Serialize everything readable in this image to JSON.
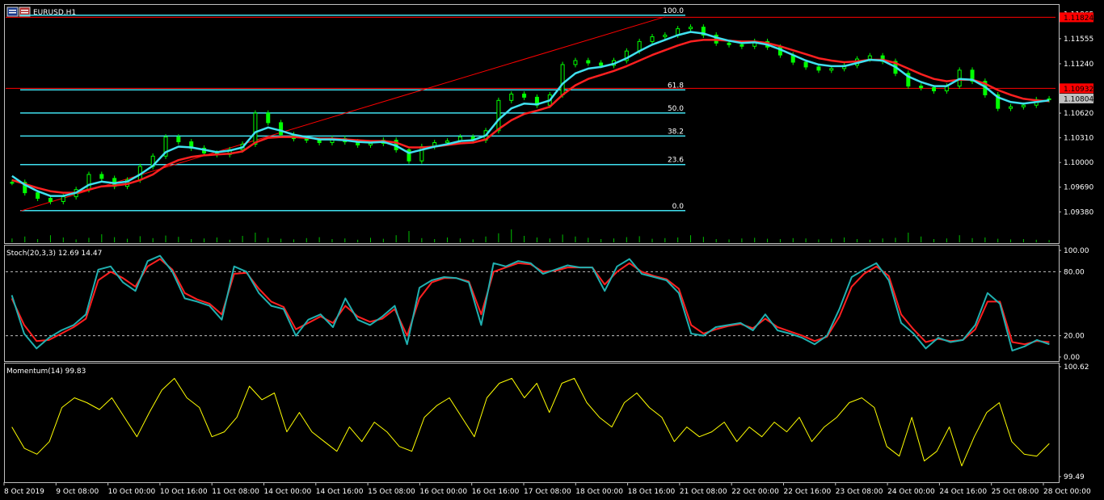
{
  "window": {
    "title": "EURUSD,H1",
    "icon": "window-icon"
  },
  "colors": {
    "background": "#000000",
    "frame": "#c0c0c0",
    "bull_candle": "#00ff00",
    "ma_fast": "#40e0f0",
    "ma_slow": "#ff2020",
    "fibo": "#40e0f0",
    "trendline": "#ff0000",
    "volume": "#00c000",
    "stoch_main": "#20b0b0",
    "stoch_signal": "#ff2020",
    "momentum": "#ffff00",
    "level_line": "#c0c0c0",
    "price_tag_high": "#ff0000",
    "price_tag_current": "#c0c0c0"
  },
  "chart_data": [
    {
      "type": "line",
      "subtype": "candlestick",
      "title": "EURUSD,H1",
      "ylim": [
        1.0918,
        1.1196
      ],
      "price_axis_labels": [
        "1.11865",
        "1.11555",
        "1.11240",
        "1.10932",
        "1.10620",
        "1.10310",
        "1.10000",
        "1.09690",
        "1.09380"
      ],
      "price_axis_values": [
        1.11865,
        1.11555,
        1.1124,
        1.10932,
        1.1062,
        1.1031,
        1.1,
        1.0969,
        1.0938
      ],
      "price_tags": [
        {
          "label": "1.11824",
          "value": 1.11824,
          "color": "#ff0000"
        },
        {
          "label": "1.10932",
          "value": 1.10932,
          "color": "#ff0000"
        },
        {
          "label": "1.10804",
          "value": 1.10804,
          "color": "#c0c0c0"
        }
      ],
      "horizontal_lines": [
        1.11824,
        1.10932
      ],
      "fibonacci": {
        "low": 1.09395,
        "high": 1.1185,
        "levels": [
          {
            "label": "100.0",
            "ratio": 1.0
          },
          {
            "label": "61.8",
            "ratio": 0.618
          },
          {
            "label": "50.0",
            "ratio": 0.5
          },
          {
            "label": "38.2",
            "ratio": 0.382
          },
          {
            "label": "23.6",
            "ratio": 0.236
          },
          {
            "label": "0.0",
            "ratio": 0.0
          }
        ]
      },
      "trendline": {
        "from": {
          "bar": 0.014,
          "value": 1.0939
        },
        "to": {
          "bar": 0.628,
          "value": 1.1183
        }
      },
      "close_series": [
        1.0975,
        1.0962,
        1.0955,
        1.0951,
        1.0957,
        1.0966,
        1.0985,
        1.098,
        1.097,
        1.0978,
        1.0995,
        1.1008,
        1.1032,
        1.1026,
        1.1018,
        1.1012,
        1.101,
        1.1016,
        1.1023,
        1.1062,
        1.105,
        1.1035,
        1.103,
        1.1028,
        1.1025,
        1.103,
        1.1026,
        1.1022,
        1.1024,
        1.1028,
        1.1016,
        1.1002,
        1.102,
        1.1025,
        1.1027,
        1.1032,
        1.1028,
        1.104,
        1.1078,
        1.1086,
        1.1082,
        1.1072,
        1.1085,
        1.1123,
        1.1128,
        1.1125,
        1.1122,
        1.1128,
        1.114,
        1.1152,
        1.1158,
        1.116,
        1.1168,
        1.117,
        1.116,
        1.115,
        1.1148,
        1.1146,
        1.1152,
        1.1145,
        1.1135,
        1.1126,
        1.112,
        1.1116,
        1.1118,
        1.1122,
        1.113,
        1.1134,
        1.1127,
        1.1112,
        1.1096,
        1.1094,
        1.109,
        1.1096,
        1.1116,
        1.1102,
        1.1085,
        1.1068,
        1.107,
        1.1072,
        1.1079,
        1.108
      ],
      "ma_fast_series": [
        1.0983,
        1.0972,
        1.0964,
        1.0958,
        1.0958,
        1.0962,
        1.0972,
        1.0976,
        1.0974,
        1.0976,
        1.0985,
        1.0996,
        1.1013,
        1.102,
        1.1019,
        1.1016,
        1.1013,
        1.1015,
        1.1019,
        1.1038,
        1.1044,
        1.104,
        1.1035,
        1.1032,
        1.1029,
        1.1029,
        1.1028,
        1.1026,
        1.1025,
        1.1026,
        1.1021,
        1.1012,
        1.1016,
        1.102,
        1.1023,
        1.1027,
        1.1028,
        1.1034,
        1.1054,
        1.1068,
        1.1074,
        1.1073,
        1.1078,
        1.1099,
        1.1112,
        1.1118,
        1.112,
        1.1124,
        1.1131,
        1.114,
        1.1148,
        1.1154,
        1.116,
        1.1164,
        1.1162,
        1.1157,
        1.1153,
        1.115,
        1.1151,
        1.1148,
        1.1142,
        1.1135,
        1.1128,
        1.1123,
        1.1121,
        1.1121,
        1.1125,
        1.1129,
        1.1128,
        1.112,
        1.1108,
        1.1101,
        1.1096,
        1.1096,
        1.1105,
        1.1104,
        1.1095,
        1.1082,
        1.1076,
        1.1074,
        1.1076,
        1.1078
      ],
      "ma_slow_series": [
        1.0978,
        1.0973,
        1.0968,
        1.0964,
        1.0962,
        1.0962,
        1.0966,
        1.097,
        1.0971,
        1.0973,
        1.0978,
        1.0985,
        1.0996,
        1.1003,
        1.1007,
        1.1009,
        1.101,
        1.1011,
        1.1014,
        1.1025,
        1.1031,
        1.1032,
        1.1032,
        1.1031,
        1.103,
        1.103,
        1.1029,
        1.1028,
        1.1027,
        1.1027,
        1.1025,
        1.1019,
        1.1019,
        1.102,
        1.1022,
        1.1024,
        1.1025,
        1.1029,
        1.1042,
        1.1053,
        1.1061,
        1.1065,
        1.107,
        1.1085,
        1.1097,
        1.1105,
        1.111,
        1.1115,
        1.1121,
        1.1128,
        1.1135,
        1.1141,
        1.1147,
        1.1152,
        1.1154,
        1.1154,
        1.1153,
        1.1152,
        1.1152,
        1.115,
        1.1146,
        1.1141,
        1.1136,
        1.1131,
        1.1128,
        1.1126,
        1.1127,
        1.1129,
        1.1129,
        1.1125,
        1.1118,
        1.1111,
        1.1105,
        1.1102,
        1.1104,
        1.1104,
        1.1099,
        1.1091,
        1.1085,
        1.108,
        1.1078,
        1.1077
      ],
      "volume_series": [
        12,
        18,
        10,
        22,
        15,
        9,
        14,
        25,
        16,
        11,
        19,
        13,
        21,
        17,
        10,
        12,
        15,
        8,
        20,
        30,
        14,
        11,
        9,
        13,
        16,
        10,
        12,
        8,
        14,
        11,
        22,
        35,
        13,
        10,
        15,
        12,
        9,
        18,
        28,
        40,
        20,
        15,
        12,
        24,
        18,
        14,
        10,
        12,
        16,
        19,
        11,
        13,
        15,
        22,
        17,
        10,
        9,
        12,
        14,
        11,
        10,
        13,
        12,
        9,
        11,
        15,
        10,
        8,
        12,
        14,
        30,
        18,
        10,
        12,
        22,
        13,
        15,
        11,
        9,
        10,
        8,
        7
      ],
      "x_axis_labels": [
        "8 Oct 2019",
        "9 Oct 08:00",
        "10 Oct 00:00",
        "10 Oct 16:00",
        "11 Oct 08:00",
        "14 Oct 00:00",
        "14 Oct 16:00",
        "15 Oct 08:00",
        "16 Oct 00:00",
        "16 Oct 16:00",
        "17 Oct 08:00",
        "18 Oct 00:00",
        "18 Oct 16:00",
        "21 Oct 08:00",
        "22 Oct 00:00",
        "22 Oct 16:00",
        "23 Oct 08:00",
        "24 Oct 00:00",
        "24 Oct 16:00",
        "25 Oct 08:00",
        "28 Oct 00:00"
      ],
      "grid": false
    },
    {
      "type": "line",
      "title": "Stoch(20,3,3) 12.69 14.47",
      "indicator_name": "Stoch(20,3,3)",
      "current_values": [
        "12.69",
        "14.47"
      ],
      "ylim": [
        0,
        100
      ],
      "axis_labels": [
        "100.00",
        "80.00",
        "20.00",
        "0.00"
      ],
      "axis_values": [
        100,
        80,
        20,
        0
      ],
      "levels": [
        80,
        20
      ],
      "series": [
        {
          "values": [
            58,
            22,
            8,
            18,
            25,
            30,
            40,
            82,
            85,
            70,
            62,
            90,
            95,
            80,
            55,
            52,
            48,
            35,
            85,
            80,
            60,
            48,
            45,
            20,
            35,
            40,
            28,
            55,
            35,
            30,
            38,
            48,
            12,
            65,
            72,
            75,
            74,
            70,
            30,
            88,
            85,
            90,
            88,
            78,
            82,
            86,
            84,
            84,
            62,
            85,
            92,
            78,
            75,
            72,
            60,
            22,
            20,
            28,
            30,
            32,
            25,
            40,
            25,
            22,
            18,
            12,
            20,
            45,
            75,
            82,
            88,
            72,
            32,
            22,
            8,
            18,
            14,
            16,
            30,
            60,
            50,
            6,
            10,
            16,
            12
          ]
        },
        {
          "values": [
            55,
            30,
            15,
            16,
            22,
            28,
            36,
            72,
            80,
            74,
            66,
            85,
            92,
            82,
            60,
            54,
            50,
            40,
            78,
            79,
            64,
            52,
            47,
            26,
            32,
            38,
            32,
            48,
            38,
            33,
            36,
            45,
            20,
            55,
            70,
            74,
            74,
            71,
            40,
            80,
            84,
            88,
            87,
            80,
            81,
            84,
            84,
            84,
            68,
            80,
            88,
            80,
            76,
            73,
            64,
            30,
            22,
            26,
            29,
            31,
            27,
            36,
            28,
            24,
            20,
            15,
            19,
            38,
            66,
            78,
            85,
            76,
            40,
            26,
            14,
            17,
            15,
            16,
            26,
            52,
            52,
            14,
            12,
            15,
            14
          ]
        }
      ]
    },
    {
      "type": "line",
      "title": "Momentum(14) 99.83",
      "indicator_name": "Momentum(14)",
      "current_value": "99.83",
      "ylim": [
        99.49,
        100.62
      ],
      "axis_labels": [
        "100.62",
        "99.49"
      ],
      "axis_values": [
        100.62,
        99.49
      ],
      "series": [
        {
          "values": [
            100.0,
            99.78,
            99.72,
            99.85,
            100.2,
            100.3,
            100.25,
            100.18,
            100.3,
            100.1,
            99.9,
            100.15,
            100.38,
            100.5,
            100.3,
            100.2,
            99.9,
            99.95,
            100.1,
            100.42,
            100.28,
            100.35,
            99.95,
            100.15,
            99.95,
            99.85,
            99.75,
            100.0,
            99.85,
            100.05,
            99.95,
            99.8,
            99.75,
            100.1,
            100.22,
            100.3,
            100.1,
            99.9,
            100.3,
            100.45,
            100.5,
            100.3,
            100.45,
            100.15,
            100.45,
            100.5,
            100.25,
            100.1,
            100.0,
            100.25,
            100.35,
            100.2,
            100.1,
            99.85,
            100.0,
            99.9,
            99.95,
            100.05,
            99.85,
            100.0,
            99.9,
            100.05,
            99.95,
            100.1,
            99.85,
            100.0,
            100.1,
            100.25,
            100.3,
            100.2,
            99.8,
            99.7,
            100.1,
            99.65,
            99.75,
            100.0,
            99.6,
            99.9,
            100.15,
            100.25,
            99.85,
            99.72,
            99.7,
            99.83
          ]
        }
      ]
    }
  ]
}
